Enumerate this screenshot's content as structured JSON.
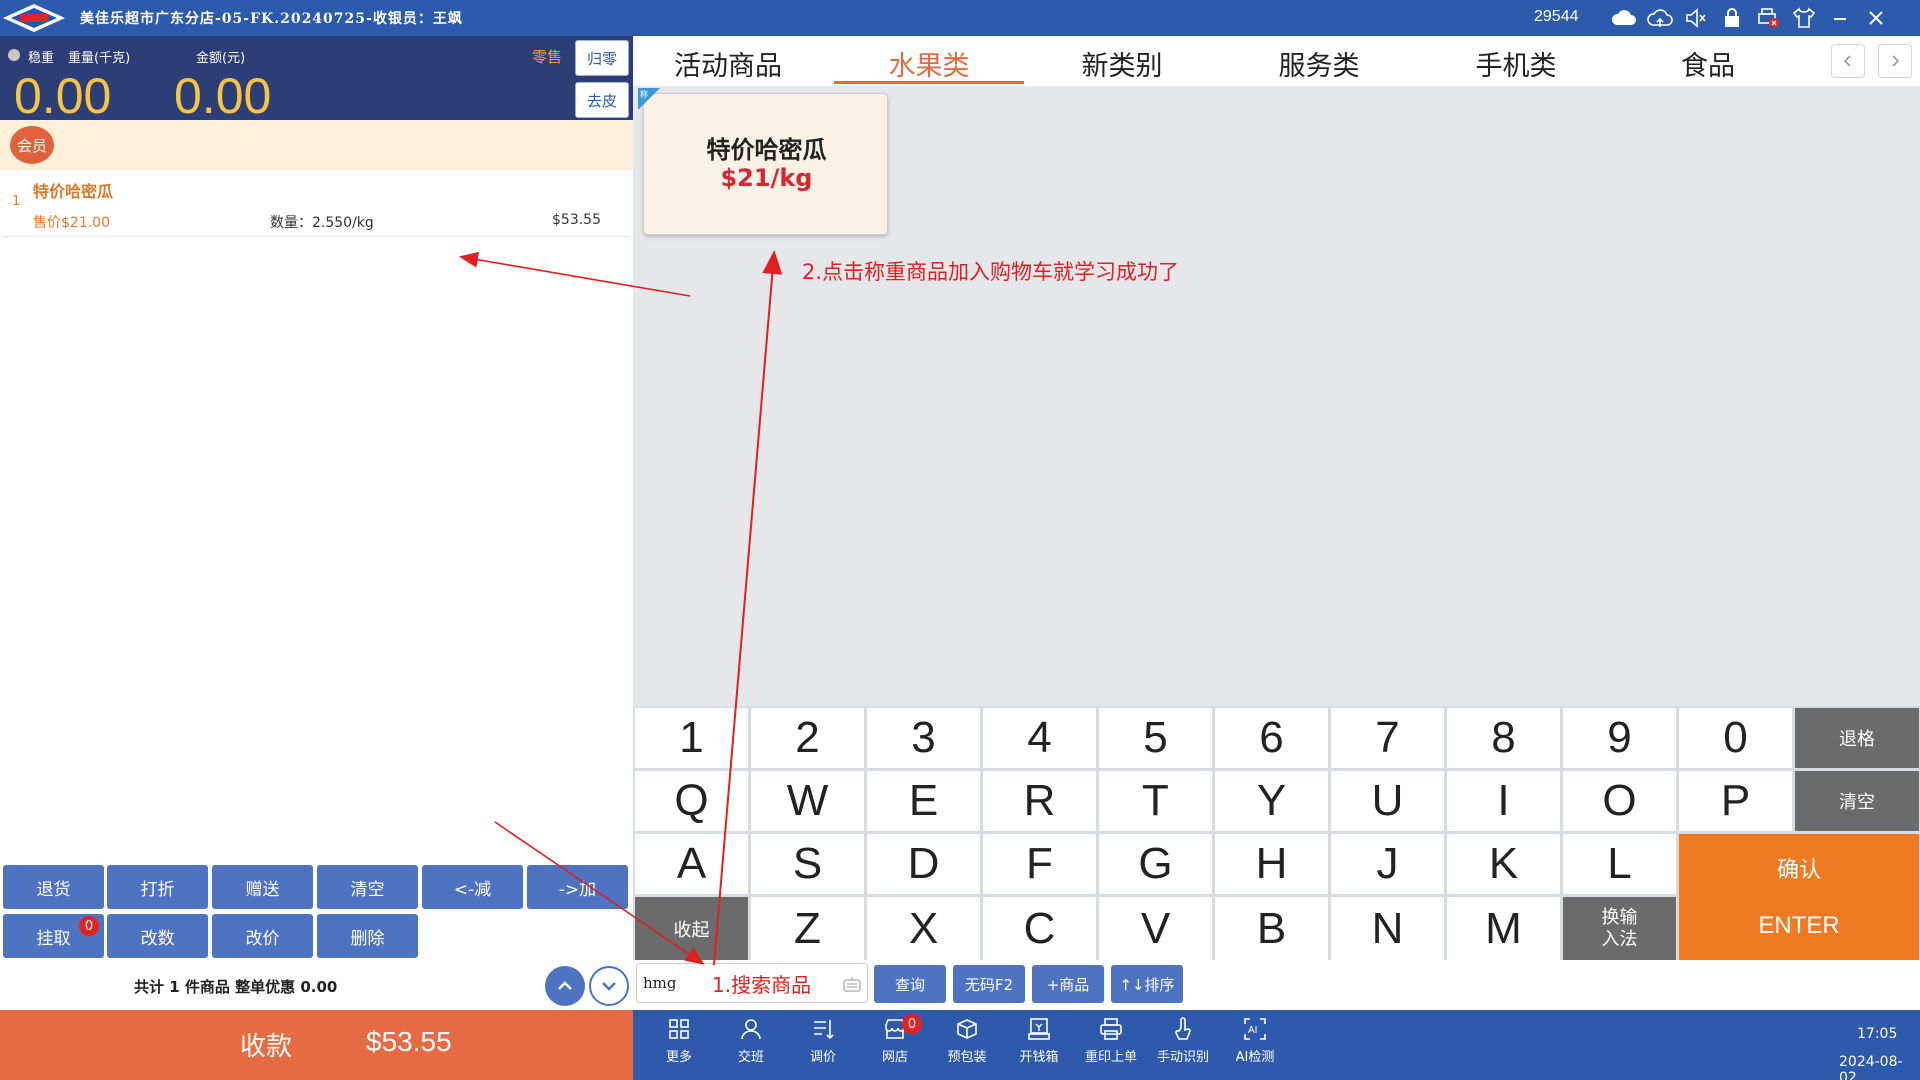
{
  "titlebar": {
    "logo_text": "AIBAO",
    "title": "美佳乐超市广东分店-05-FK.20240725-收银员：王飒",
    "code": "29544",
    "icons": [
      "cloud-icon",
      "cloud-upload-icon",
      "speaker-mute-icon",
      "lock-icon",
      "printer-error-icon",
      "shirt-icon"
    ],
    "controls": [
      "minimize-icon",
      "close-icon"
    ]
  },
  "scale": {
    "stable_label": "稳重",
    "weight_label": "重量(千克)",
    "amount_label": "金额(元)",
    "sale_type": "零售",
    "weight_value": "0.00",
    "amount_value": "0.00",
    "zero_label": "归零",
    "tare_label": "去皮"
  },
  "member": {
    "label": "会员"
  },
  "cart": {
    "items": [
      {
        "index": "1",
        "name": "特价哈密瓜",
        "price": "售价$21.00",
        "qty": "数量：2.550/kg",
        "subtotal": "$53.55"
      }
    ]
  },
  "func_buttons": {
    "return": "退货",
    "discount": "打折",
    "gift": "赠送",
    "clear": "清空",
    "minus": "<-减",
    "plus": "->加",
    "hold": "挂取",
    "hold_badge": "0",
    "change_qty": "改数",
    "change_price": "改价",
    "delete": "删除"
  },
  "summary": "共计 1 件商品 整单优惠 0.00",
  "pay": {
    "label": "收款",
    "amount": "$53.55"
  },
  "categories": {
    "tabs": [
      "活动商品",
      "水果类",
      "新类别",
      "服务类",
      "手机类",
      "食品"
    ],
    "active_index": 1
  },
  "product": {
    "flag": "称",
    "name": "特价哈密瓜",
    "price": "$21/kg"
  },
  "annotations": {
    "step1": "1.搜索商品",
    "step2": "2.点击称重商品加入购物车就学习成功了",
    "arrow_color": "#e02020"
  },
  "keyboard": {
    "numbers": [
      "1",
      "2",
      "3",
      "4",
      "5",
      "6",
      "7",
      "8",
      "9",
      "0"
    ],
    "row_q": [
      "Q",
      "W",
      "E",
      "R",
      "T",
      "Y",
      "U",
      "I",
      "O",
      "P"
    ],
    "row_a": [
      "A",
      "S",
      "D",
      "F",
      "G",
      "H",
      "J",
      "K",
      "L"
    ],
    "row_z": [
      "Z",
      "X",
      "C",
      "V",
      "B",
      "N",
      "M"
    ],
    "backspace": "退格",
    "clear": "清空",
    "collapse": "收起",
    "ime_line1": "换输",
    "ime_line2": "入法",
    "confirm": "确认",
    "enter": "ENTER"
  },
  "search": {
    "value": "hmg",
    "query": "查询",
    "no_code": "无码F2",
    "add_product": "+商品",
    "sort": "↑↓排序"
  },
  "toolbar": {
    "more": "更多",
    "shift": "交班",
    "adjust_price": "调价",
    "online_store": "网店",
    "online_badge": "0",
    "prepack": "预包装",
    "cash_drawer": "开钱箱",
    "reprint": "重印上单",
    "manual_recog": "手动识别",
    "ai_detect": "AI检测",
    "time": "17:05",
    "date": "2024-08-02"
  },
  "colors": {
    "titlebar": "#2d5bab",
    "accent_orange": "#e66b42",
    "button_blue": "#4d73c1",
    "price_red": "#d8262e",
    "digit_yellow": "#f6c640"
  }
}
